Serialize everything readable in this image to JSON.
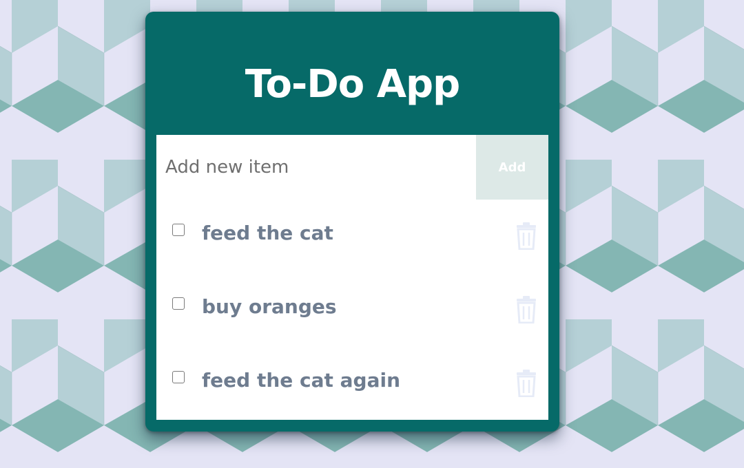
{
  "app": {
    "title": "To-Do App"
  },
  "add_form": {
    "placeholder": "Add new item",
    "value": "",
    "button_label": "Add"
  },
  "todos": [
    {
      "text": "feed the cat",
      "done": false
    },
    {
      "text": "buy oranges",
      "done": false
    },
    {
      "text": "feed the cat again",
      "done": false
    }
  ],
  "icons": {
    "delete": "trash-icon",
    "checkbox": "checkbox-icon"
  },
  "colors": {
    "header": "#066a68",
    "panel": "#ffffff",
    "add_button_bg": "#dde9e7",
    "item_text": "#6e7c8f",
    "trash": "#e6ebf7",
    "pattern_light": "#e4e4f5",
    "pattern_mid": "#b5d0d6",
    "pattern_dark": "#84b6b3"
  }
}
